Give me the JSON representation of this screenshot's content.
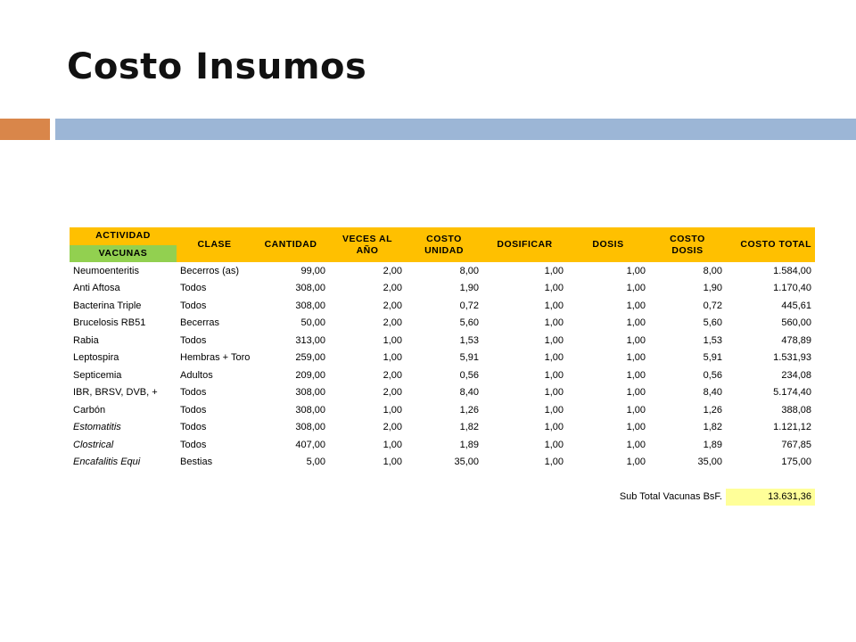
{
  "title": "Costo Insumos",
  "colors": {
    "accent_orange": "#d9864a",
    "accent_blue": "#9cb6d6",
    "header_yellow": "#ffc000",
    "header_green": "#92d050",
    "total_highlight": "#ffff99"
  },
  "table": {
    "headers": {
      "actividad": "ACTIVIDAD",
      "vacunas": "VACUNAS",
      "clase": "CLASE",
      "cantidad": "CANTIDAD",
      "veces_line1": "VECES AL",
      "veces_line2": "AÑO",
      "costo_unidad_line1": "COSTO",
      "costo_unidad_line2": "UNIDAD",
      "dosificar": "DOSIFICAR",
      "dosis": "DOSIS",
      "costo_dosis_line1": "COSTO",
      "costo_dosis_line2": "DOSIS",
      "costo_total": "COSTO TOTAL"
    },
    "rows": [
      {
        "actividad": "Neumoenteritis",
        "italic": false,
        "clase": "Becerros (as)",
        "cantidad": "99,00",
        "veces": "2,00",
        "costo_unidad": "8,00",
        "dosificar": "1,00",
        "dosis": "1,00",
        "costo_dosis": "8,00",
        "costo_total": "1.584,00"
      },
      {
        "actividad": "Anti Aftosa",
        "italic": false,
        "clase": "Todos",
        "cantidad": "308,00",
        "veces": "2,00",
        "costo_unidad": "1,90",
        "dosificar": "1,00",
        "dosis": "1,00",
        "costo_dosis": "1,90",
        "costo_total": "1.170,40"
      },
      {
        "actividad": "Bacterina Triple",
        "italic": false,
        "clase": "Todos",
        "cantidad": "308,00",
        "veces": "2,00",
        "costo_unidad": "0,72",
        "dosificar": "1,00",
        "dosis": "1,00",
        "costo_dosis": "0,72",
        "costo_total": "445,61"
      },
      {
        "actividad": "Brucelosis RB51",
        "italic": false,
        "clase": "Becerras",
        "cantidad": "50,00",
        "veces": "2,00",
        "costo_unidad": "5,60",
        "dosificar": "1,00",
        "dosis": "1,00",
        "costo_dosis": "5,60",
        "costo_total": "560,00"
      },
      {
        "actividad": "Rabia",
        "italic": false,
        "clase": "Todos",
        "cantidad": "313,00",
        "veces": "1,00",
        "costo_unidad": "1,53",
        "dosificar": "1,00",
        "dosis": "1,00",
        "costo_dosis": "1,53",
        "costo_total": "478,89"
      },
      {
        "actividad": "Leptospira",
        "italic": false,
        "clase": "Hembras + Toro",
        "cantidad": "259,00",
        "veces": "1,00",
        "costo_unidad": "5,91",
        "dosificar": "1,00",
        "dosis": "1,00",
        "costo_dosis": "5,91",
        "costo_total": "1.531,93"
      },
      {
        "actividad": "Septicemia",
        "italic": false,
        "clase": "Adultos",
        "cantidad": "209,00",
        "veces": "2,00",
        "costo_unidad": "0,56",
        "dosificar": "1,00",
        "dosis": "1,00",
        "costo_dosis": "0,56",
        "costo_total": "234,08"
      },
      {
        "actividad": "IBR, BRSV, DVB, +",
        "italic": false,
        "clase": "Todos",
        "cantidad": "308,00",
        "veces": "2,00",
        "costo_unidad": "8,40",
        "dosificar": "1,00",
        "dosis": "1,00",
        "costo_dosis": "8,40",
        "costo_total": "5.174,40"
      },
      {
        "actividad": "Carbón",
        "italic": false,
        "clase": "Todos",
        "cantidad": "308,00",
        "veces": "1,00",
        "costo_unidad": "1,26",
        "dosificar": "1,00",
        "dosis": "1,00",
        "costo_dosis": "1,26",
        "costo_total": "388,08"
      },
      {
        "actividad": "Estomatitis",
        "italic": true,
        "clase": "Todos",
        "cantidad": "308,00",
        "veces": "2,00",
        "costo_unidad": "1,82",
        "dosificar": "1,00",
        "dosis": "1,00",
        "costo_dosis": "1,82",
        "costo_total": "1.121,12"
      },
      {
        "actividad": "Clostrical",
        "italic": true,
        "clase": "Todos",
        "cantidad": "407,00",
        "veces": "1,00",
        "costo_unidad": "1,89",
        "dosificar": "1,00",
        "dosis": "1,00",
        "costo_dosis": "1,89",
        "costo_total": "767,85"
      },
      {
        "actividad": "Encafalitis Equi",
        "italic": true,
        "clase": "Bestias",
        "cantidad": "5,00",
        "veces": "1,00",
        "costo_unidad": "35,00",
        "dosificar": "1,00",
        "dosis": "1,00",
        "costo_dosis": "35,00",
        "costo_total": "175,00"
      }
    ],
    "subtotal": {
      "label": "Sub Total Vacunas BsF.",
      "value": "13.631,36"
    }
  }
}
